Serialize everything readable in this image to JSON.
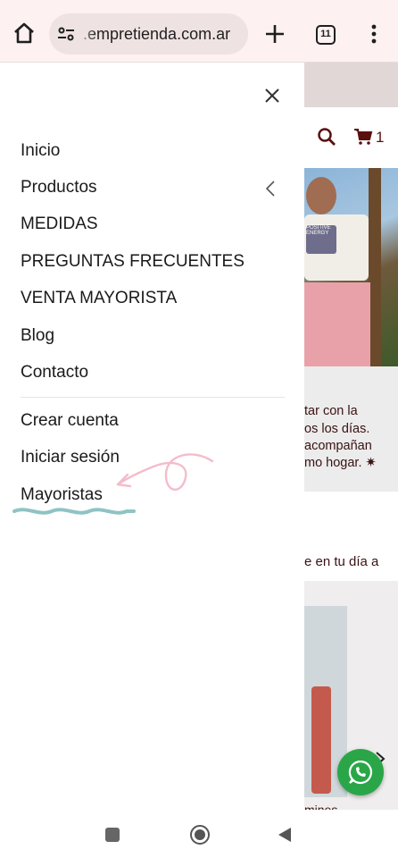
{
  "browser": {
    "url": ".empretienda.com.ar",
    "tab_count": "11",
    "icons": [
      "home-icon",
      "tune-icon",
      "plus-icon",
      "tabs-icon",
      "more-vert-icon"
    ]
  },
  "drawer": {
    "menu": [
      {
        "label": "Inicio"
      },
      {
        "label": "Productos",
        "has_submenu": true
      },
      {
        "label": "MEDIDAS"
      },
      {
        "label": "PREGUNTAS FRECUENTES"
      },
      {
        "label": "VENTA MAYORISTA"
      },
      {
        "label": "Blog"
      },
      {
        "label": "Contacto"
      }
    ],
    "account": [
      {
        "label": "Crear cuenta"
      },
      {
        "label": "Iniciar sesión"
      },
      {
        "label": "Mayoristas"
      }
    ]
  },
  "site": {
    "cart_count": "1",
    "shirt_print": "POSITIVE ENERGY",
    "text_lines": [
      "tar con la",
      "os los días.",
      "acompañan",
      "mo hogar. ✷"
    ],
    "text_line2": "e en tu día a",
    "bottom_text": "mines"
  },
  "colors": {
    "topbar": "#fdf1f1",
    "urlbox": "#efe2e2",
    "brand_text": "#5b1010",
    "annotation_pink": "#f4bccb",
    "annotation_teal": "#8fc3c4",
    "whatsapp": "#2aa648"
  }
}
